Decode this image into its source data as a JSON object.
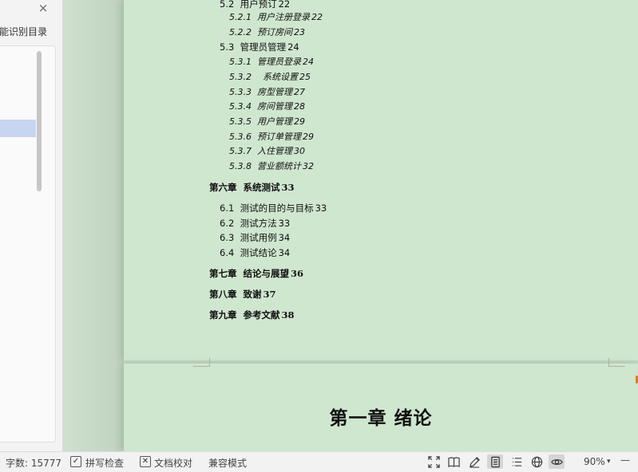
{
  "nav_pane": {
    "title": "智能识别目录",
    "close_symbol": "×",
    "close_icon": "close-icon"
  },
  "toc": [
    {
      "level": 2,
      "text": "5.2  用户预订",
      "page": "22"
    },
    {
      "level": 3,
      "text": "5.2.1  用户注册登录",
      "page": "22"
    },
    {
      "level": 3,
      "text": "5.2.2  预订房间",
      "page": "23"
    },
    {
      "level": 2,
      "text": "5.3  管理员管理",
      "page": "24"
    },
    {
      "level": 3,
      "text": "5.3.1  管理员登录",
      "page": "24"
    },
    {
      "level": 3,
      "text": "5.3.2    系统设置",
      "page": "25"
    },
    {
      "level": 3,
      "text": "5.3.3  房型管理",
      "page": "27"
    },
    {
      "level": 3,
      "text": "5.3.4  房间管理",
      "page": "28"
    },
    {
      "level": 3,
      "text": "5.3.5  用户管理",
      "page": "29"
    },
    {
      "level": 3,
      "text": "5.3.6  预订单管理",
      "page": "29"
    },
    {
      "level": 3,
      "text": "5.3.7  入住管理",
      "page": "30"
    },
    {
      "level": 3,
      "text": "5.3.8  营业额统计",
      "page": "32"
    },
    {
      "level": 1,
      "text": "第六章  系统测试",
      "page": "33"
    },
    {
      "level": 2,
      "text": "6.1  测试的目的与目标",
      "page": "33"
    },
    {
      "level": 2,
      "text": "6.2  测试方法",
      "page": "33"
    },
    {
      "level": 2,
      "text": "6.3  测试用例",
      "page": "34"
    },
    {
      "level": 2,
      "text": "6.4  测试结论",
      "page": "34"
    },
    {
      "level": 1,
      "text": "第七章  结论与展望",
      "page": "36"
    },
    {
      "level": 1,
      "text": "第八章  致谢",
      "page": "37"
    },
    {
      "level": 1,
      "text": "第九章  参考文献",
      "page": "38"
    }
  ],
  "chapter_heading": "第一章  绪论",
  "status_bar": {
    "word_count": "字数: 15777",
    "spell_check": "拼写检查",
    "doc_proof": "文档校对",
    "compat_mode": "兼容模式",
    "zoom": "90%",
    "zoom_caret": "▾",
    "zoom_minus": "—",
    "icons": [
      "fullscreen-icon",
      "reading-mode-icon",
      "annotate-icon",
      "page-view-icon",
      "outline-view-icon",
      "web-view-icon",
      "eye-protection-icon"
    ],
    "active_view": "page-view-icon",
    "colors": {
      "page_background": "#cfe6cf",
      "selection": "#c7d5f1"
    }
  }
}
